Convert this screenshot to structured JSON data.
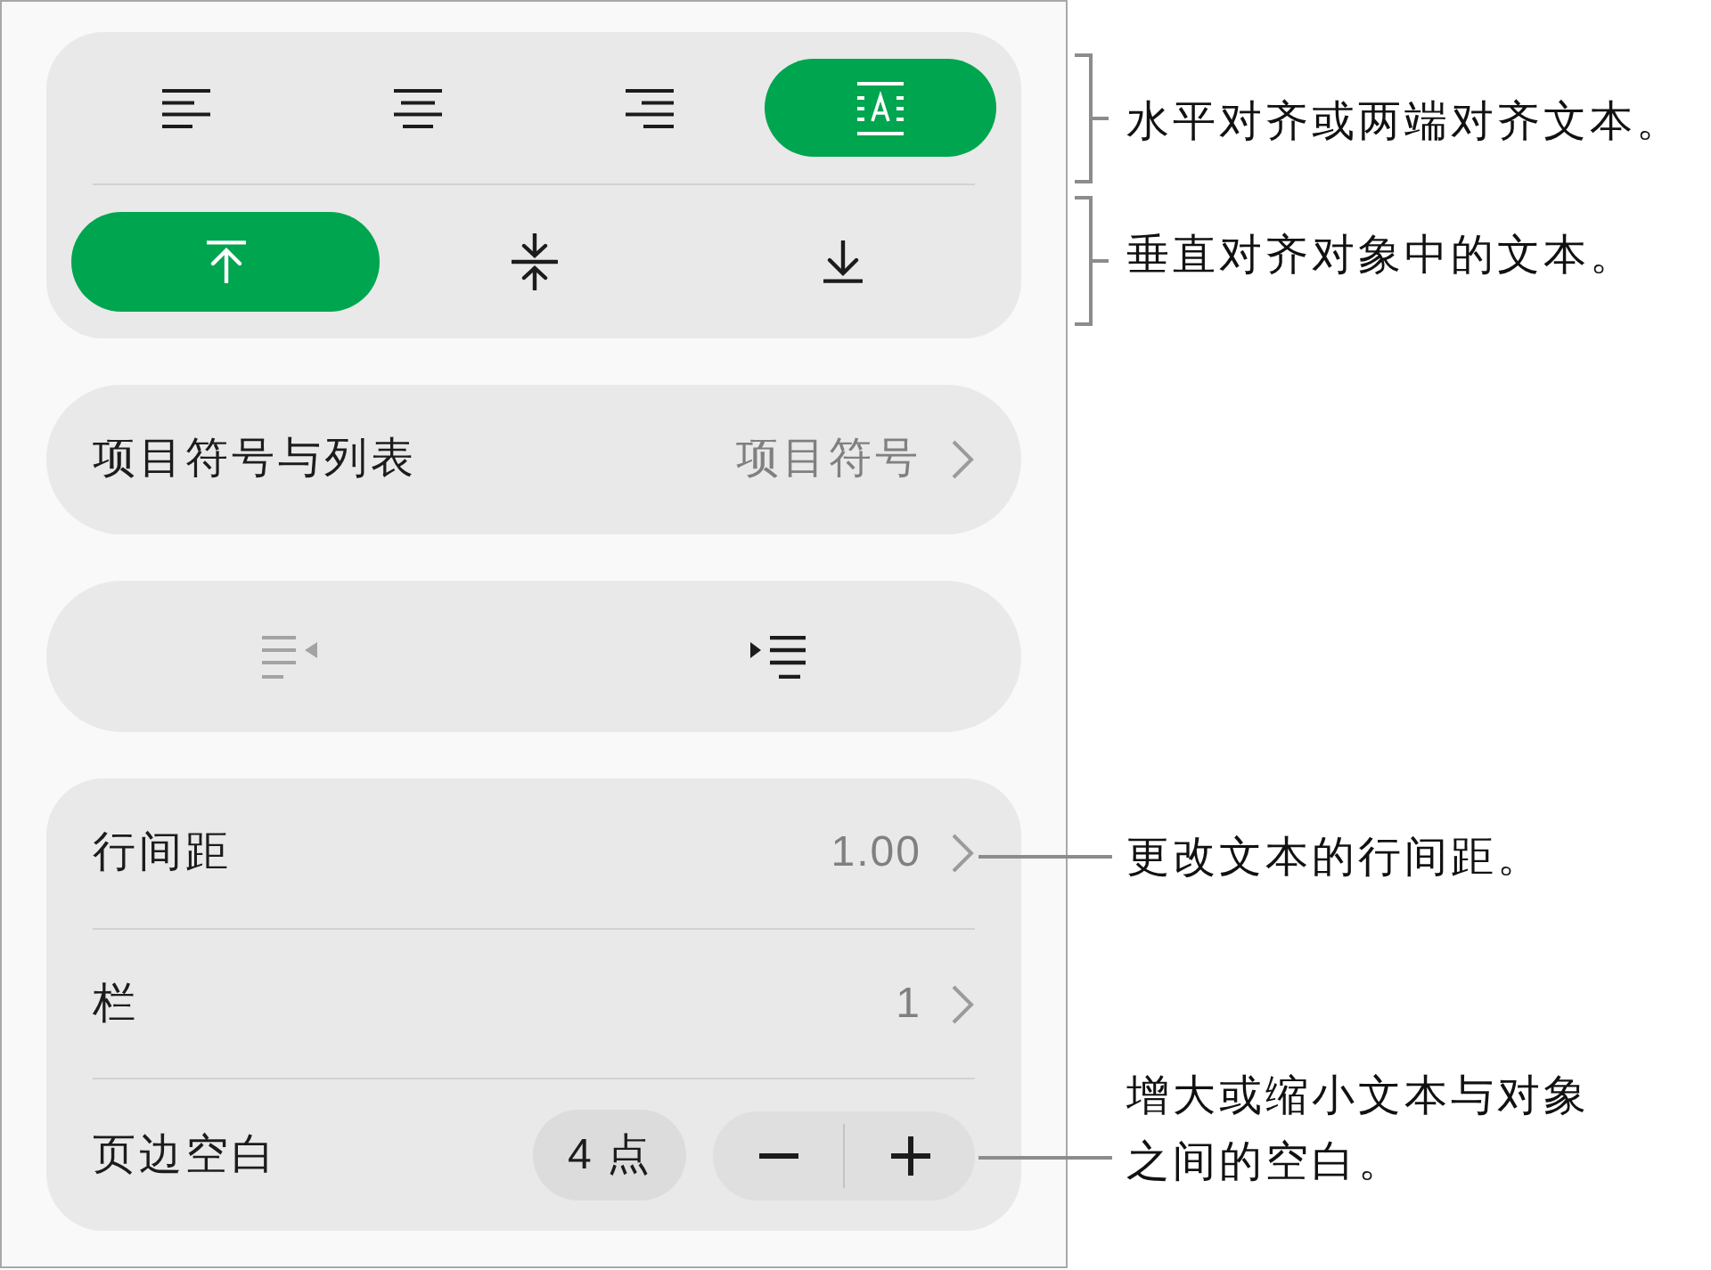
{
  "alignment_card": {
    "horizontal": [
      {
        "kind": "left",
        "selected": false
      },
      {
        "kind": "center",
        "selected": false
      },
      {
        "kind": "right",
        "selected": false
      },
      {
        "kind": "justify",
        "selected": true
      }
    ],
    "vertical": [
      {
        "kind": "top",
        "selected": true
      },
      {
        "kind": "middle",
        "selected": false
      },
      {
        "kind": "bottom",
        "selected": false
      }
    ]
  },
  "bullets_row": {
    "label": "项目符号与列表",
    "value": "项目符号"
  },
  "indent_buttons": [
    {
      "kind": "outdent",
      "disabled": true
    },
    {
      "kind": "indent",
      "disabled": false
    }
  ],
  "settings": [
    {
      "kind": "disclosure",
      "label": "行间距",
      "value": "1.00"
    },
    {
      "kind": "disclosure",
      "label": "栏",
      "value": "1"
    },
    {
      "kind": "stepper",
      "label": "页边空白",
      "value": "4 点"
    }
  ],
  "callouts": [
    {
      "kind": "bracket",
      "text": "水平对齐或两端对齐文本。"
    },
    {
      "kind": "bracket",
      "text": "垂直对齐对象中的文本。"
    },
    {
      "kind": "line",
      "text": "更改文本的行间距。"
    },
    {
      "kind": "line",
      "text": "增大或缩小文本与对象之间的空白。"
    }
  ]
}
